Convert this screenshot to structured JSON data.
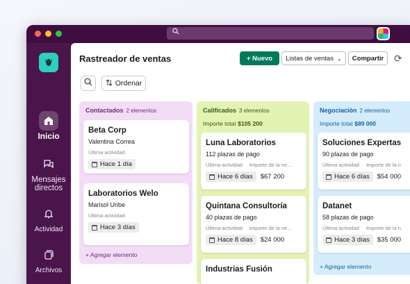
{
  "search": {
    "placeholder": ""
  },
  "sidebar": {
    "items": [
      {
        "label": "Inicio",
        "icon": "home-icon"
      },
      {
        "label": "Mensajes directos",
        "icon": "chat-bubbles-icon"
      },
      {
        "label": "Actividad",
        "icon": "bell-icon"
      },
      {
        "label": "Archivos",
        "icon": "files-icon"
      }
    ],
    "more_label": "•••"
  },
  "header": {
    "title": "Rastreador de ventas",
    "new_label": "+ Nuevo",
    "list_label": "Listas de ventas",
    "share_label": "Compartir"
  },
  "toolbar": {
    "sort_label": "Ordenar"
  },
  "columns": [
    {
      "name": "Contactados",
      "count": "2 elementos",
      "cards": [
        {
          "name": "Beta Corp",
          "contact": "Valentina Correa",
          "meta1": "Última actividad",
          "date": "Hace 1 día"
        },
        {
          "name": "Laboratorios Welo",
          "contact": "Marisol Uribe",
          "meta1": "Última actividad",
          "date": "Hace 3 días"
        }
      ],
      "add_label": "+ Agregar elemento"
    },
    {
      "name": "Calificados",
      "count": "3 elementos",
      "total_label": "Importe total",
      "total_value": "$105 200",
      "cards": [
        {
          "name": "Luna Laboratorios",
          "contact": "112 plazas de pago",
          "meta1": "Última actividad",
          "meta2": "Importe de la ne...",
          "date": "Hace 6 días",
          "amount": "$67 200"
        },
        {
          "name": "Quintana Consultoría",
          "contact": "40 plazas de pago",
          "meta1": "Última actividad",
          "meta2": "Importe de la ne...",
          "date": "Hace 8 días",
          "amount": "$24 000"
        },
        {
          "name": "Industrias Fusión"
        }
      ]
    },
    {
      "name": "Negociación",
      "count": "2 elementos",
      "total_label": "Importe total",
      "total_value": "$89 000",
      "cards": [
        {
          "name": "Soluciones Expertas",
          "contact": "90 plazas de pago",
          "meta1": "Última actividad",
          "meta2": "Importe de la n",
          "date": "Hace 6 días",
          "amount": "$54 000"
        },
        {
          "name": "Datanet",
          "contact": "58 plazas de pago",
          "meta1": "Última actividad",
          "meta2": "Importe de la n",
          "date": "Hace 3 días",
          "amount": "$35 000"
        }
      ],
      "add_label": "+ Agregar elemento"
    }
  ],
  "colors": {
    "sidebar_bg": "#4a154b",
    "accent_green": "#007a5a",
    "col_contactados": "#f3dcf6",
    "col_calificados": "#e3f3b4",
    "col_negociacion": "#d4ecfb"
  }
}
